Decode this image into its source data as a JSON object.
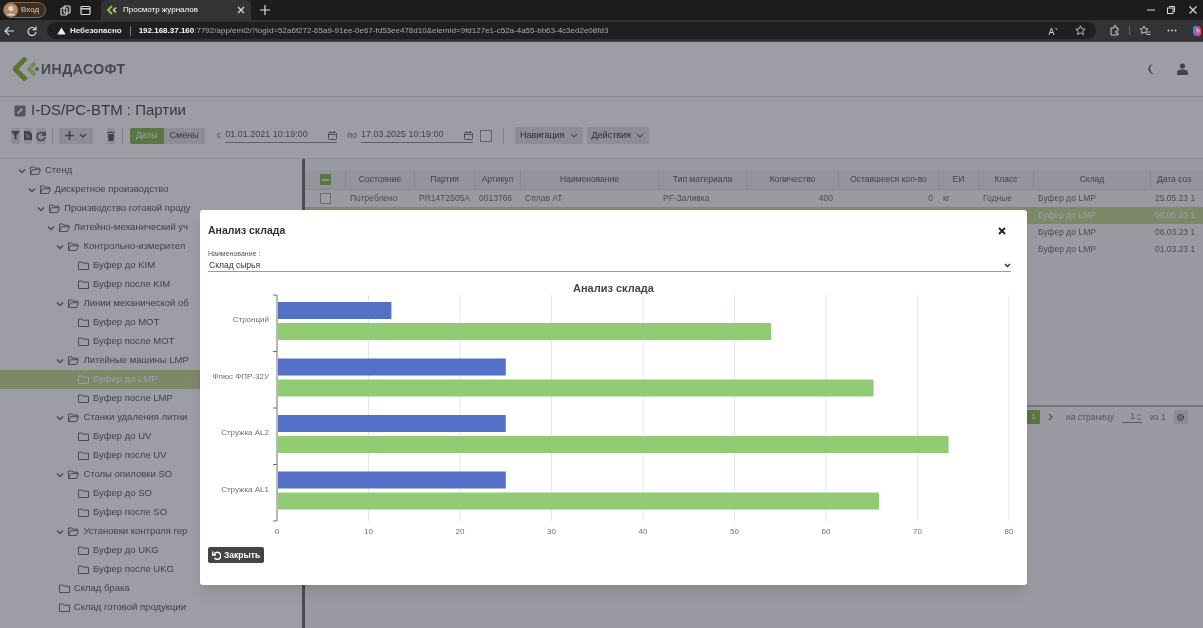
{
  "browser": {
    "profile_label": "Вход",
    "tab_title": "Просмотр журналов",
    "security_label": "Небезопасно",
    "url_host": "192.168.37.160",
    "url_rest": ":7792/app/eml2/?logId=52a6f272-65a9-91ee-0e67-fd53ee478d10&elemId=9fd127e1-c52a-4a55-bb63-4c3ed2e08fd3"
  },
  "app": {
    "logo_text": "ИНДАСОФТ",
    "page_title": "I-DS/PC-BTM : Партии"
  },
  "toolbar": {
    "mode_toggle": [
      {
        "label": "Даты",
        "selected": true
      },
      {
        "label": "Смены",
        "selected": false
      }
    ],
    "from_label": "с",
    "from_value": "01.01.2021 10:19:00",
    "to_label": "по",
    "to_value": "17.03.2025 10:19:00",
    "checked": false,
    "menus": [
      "Навигация",
      "Действия"
    ]
  },
  "tree": [
    {
      "kind": "group",
      "label": "Стенд",
      "expanded": true,
      "selected": false,
      "children": [
        {
          "kind": "group",
          "label": "Дискретное производство",
          "expanded": true,
          "selected": false,
          "children": [
            {
              "kind": "group",
              "label": "Производство готовой проду",
              "expanded": true,
              "selected": false,
              "children": [
                {
                  "kind": "group",
                  "label": "Литейно-механический уч",
                  "expanded": true,
                  "selected": false,
                  "children": [
                    {
                      "kind": "group",
                      "label": "Контрольно-измерител",
                      "expanded": true,
                      "selected": false,
                      "children": [
                        {
                          "kind": "item",
                          "label": "Буфер до KIM",
                          "selected": false
                        },
                        {
                          "kind": "item",
                          "label": "Буфер после KIM",
                          "selected": false
                        }
                      ]
                    },
                    {
                      "kind": "group",
                      "label": "Линии механической об",
                      "expanded": true,
                      "selected": false,
                      "children": [
                        {
                          "kind": "item",
                          "label": "Буфер до MOT",
                          "selected": false
                        },
                        {
                          "kind": "item",
                          "label": "Буфер после MOT",
                          "selected": false
                        }
                      ]
                    },
                    {
                      "kind": "group",
                      "label": "Литейные машины LMP",
                      "expanded": true,
                      "selected": false,
                      "children": [
                        {
                          "kind": "item",
                          "label": "Буфер до LMP",
                          "selected": true
                        },
                        {
                          "kind": "item",
                          "label": "Буфер после LMP",
                          "selected": false
                        }
                      ]
                    },
                    {
                      "kind": "group",
                      "label": "Станки удаления литни",
                      "expanded": true,
                      "selected": false,
                      "children": [
                        {
                          "kind": "item",
                          "label": "Буфер до UV",
                          "selected": false
                        },
                        {
                          "kind": "item",
                          "label": "Буфер после UV",
                          "selected": false
                        }
                      ]
                    },
                    {
                      "kind": "group",
                      "label": "Столы опиловки SO",
                      "expanded": true,
                      "selected": false,
                      "children": [
                        {
                          "kind": "item",
                          "label": "Буфер до SO",
                          "selected": false
                        },
                        {
                          "kind": "item",
                          "label": "Буфер после SO",
                          "selected": false
                        }
                      ]
                    },
                    {
                      "kind": "group",
                      "label": "Установки контроля гер",
                      "expanded": true,
                      "selected": false,
                      "children": [
                        {
                          "kind": "item",
                          "label": "Буфер до UKG",
                          "selected": false
                        },
                        {
                          "kind": "item",
                          "label": "Буфер после UKG",
                          "selected": false
                        }
                      ]
                    }
                  ]
                },
                {
                  "kind": "item",
                  "label": "Склад брака",
                  "selected": false
                },
                {
                  "kind": "item",
                  "label": "Склад готовой продукции",
                  "selected": false
                }
              ]
            }
          ]
        }
      ]
    }
  ],
  "table": {
    "header_checked": true,
    "columns": [
      "Состояние",
      "Партия",
      "Артикул",
      "Наименование",
      "Тип материала",
      "Количество",
      "Оставшееся кол-во",
      "ЕИ",
      "Класс",
      "Склад",
      "Дата соз"
    ],
    "rows": [
      {
        "selected": false,
        "checked": false,
        "cells": [
          "Потреблено",
          "PR14T2505A",
          "0013766",
          "Сплав AT",
          "PF-Заливка",
          "400",
          "0",
          "кг",
          "Годные",
          "Буфер до LMP",
          "25.05.23 1"
        ]
      },
      {
        "selected": true,
        "cells": [
          null,
          null,
          null,
          null,
          null,
          null,
          null,
          null,
          null,
          "Буфер до LMP",
          "08.05.23 1"
        ]
      },
      {
        "selected": false,
        "cells": [
          null,
          null,
          null,
          null,
          null,
          null,
          null,
          null,
          null,
          "Буфер до LMP",
          "06.03.23 1"
        ]
      },
      {
        "selected": false,
        "cells": [
          null,
          null,
          null,
          null,
          null,
          null,
          null,
          null,
          null,
          "Буфер до LMP",
          "01.03.23 1"
        ]
      }
    ]
  },
  "pagination": {
    "page": "1",
    "per_page_label": "на страницу",
    "per_page_value": "1",
    "of_label": "из 1"
  },
  "modal": {
    "title": "Анализ склада",
    "field_label": "Наименование :",
    "field_value": "Склад сырья",
    "close_button": "Закрыть",
    "chart_data": {
      "type": "bar",
      "orientation": "horizontal",
      "title": "Анализ склада",
      "categories": [
        "Стронций",
        "Флюс ФПР-32У",
        "Стружка AL2",
        "Стружка AL1"
      ],
      "series": [
        {
          "color": "#5470c6",
          "values": [
            12.5,
            25,
            25,
            25
          ]
        },
        {
          "color": "#91cc75",
          "values": [
            54,
            65.2,
            73.4,
            65.8
          ]
        }
      ],
      "grid": true,
      "xlim": [
        0,
        80
      ],
      "xticks": [
        0,
        10,
        20,
        30,
        40,
        50,
        60,
        70,
        80
      ]
    }
  }
}
